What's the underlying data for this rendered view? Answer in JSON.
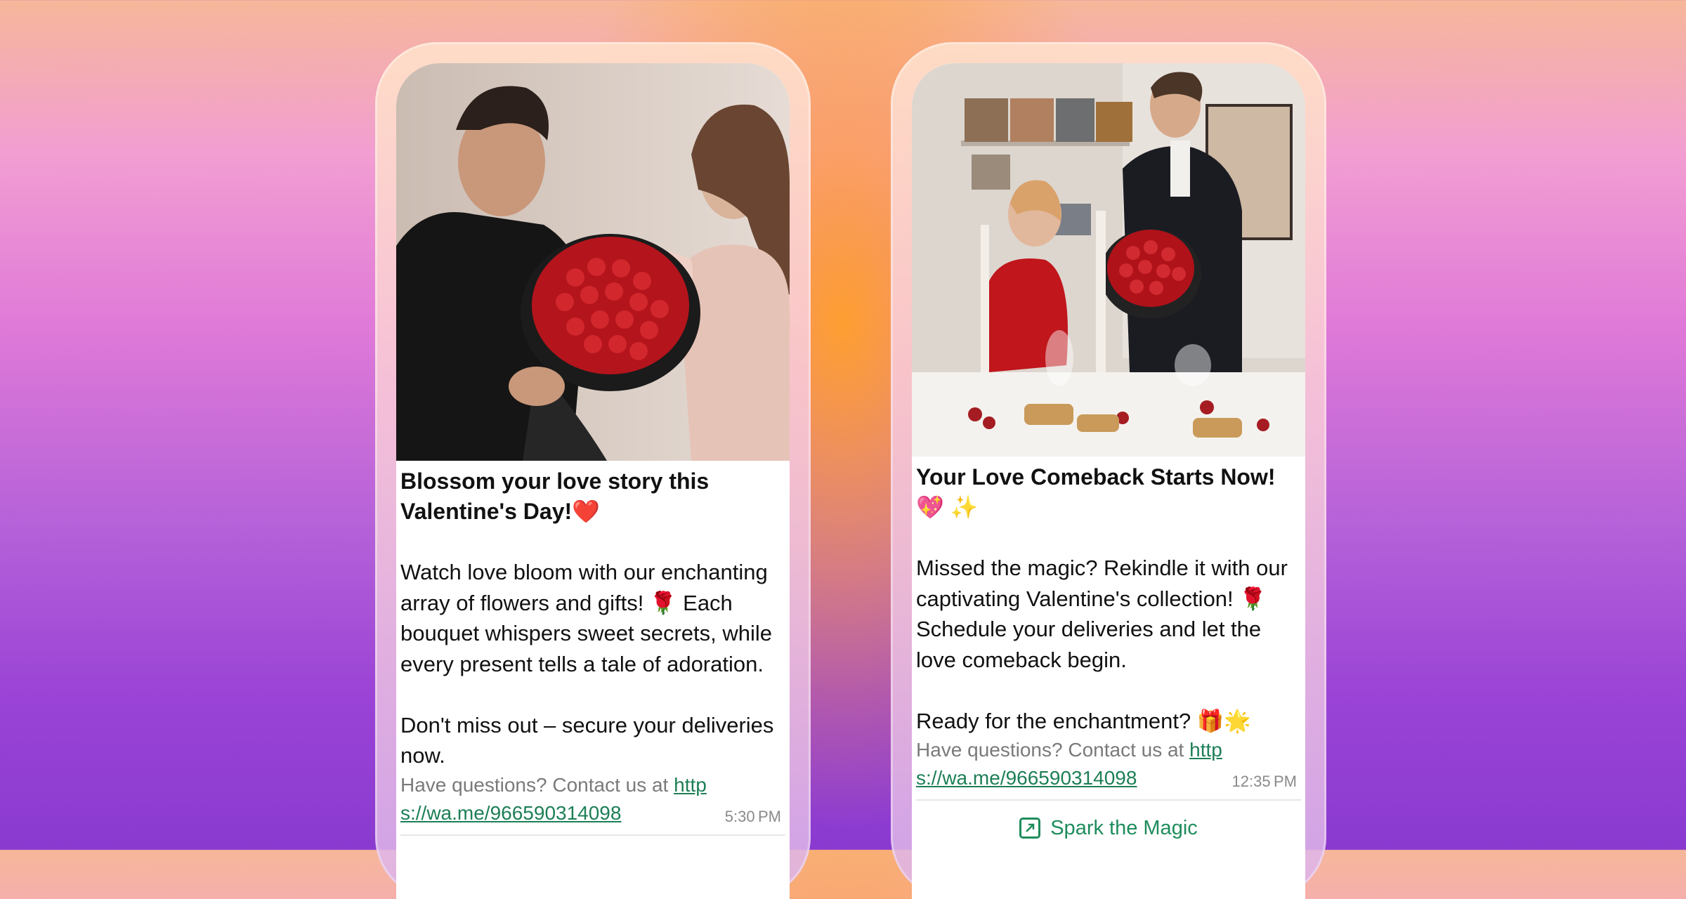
{
  "cards": [
    {
      "title": "Blossom your love story this Valentine's Day!",
      "title_emoji": "❤️",
      "body": "Watch love bloom with our enchanting array of flowers and gifts! 🌹 Each bouquet whispers sweet secrets, while every present tells a tale of adoration.\n\nDon't miss out – secure your deliveries now.",
      "footer_prefix": "Have questions? Contact us at ",
      "footer_link": "https://wa.me/966590314098",
      "time": "5:30 PM",
      "photo_icon": "couple-with-rose-bouquet-photo"
    },
    {
      "title": "Your Love Comeback Starts Now! 💖 ✨",
      "body": "Missed the magic? Rekindle it with our captivating Valentine's collection! 🌹 Schedule your deliveries and let the love comeback begin.\n\nReady for the enchantment? 🎁🌟",
      "footer_prefix": "Have questions? Contact us at ",
      "footer_link": "https://wa.me/966590314098",
      "time": "12:35 PM",
      "button_label": "Spark the Magic",
      "button_icon": "external-link-icon",
      "photo_icon": "dinner-table-bouquet-photo"
    }
  ],
  "colors": {
    "link": "#1d7f56",
    "button": "#1e8c5c",
    "footer_text": "#7a7a7a"
  }
}
